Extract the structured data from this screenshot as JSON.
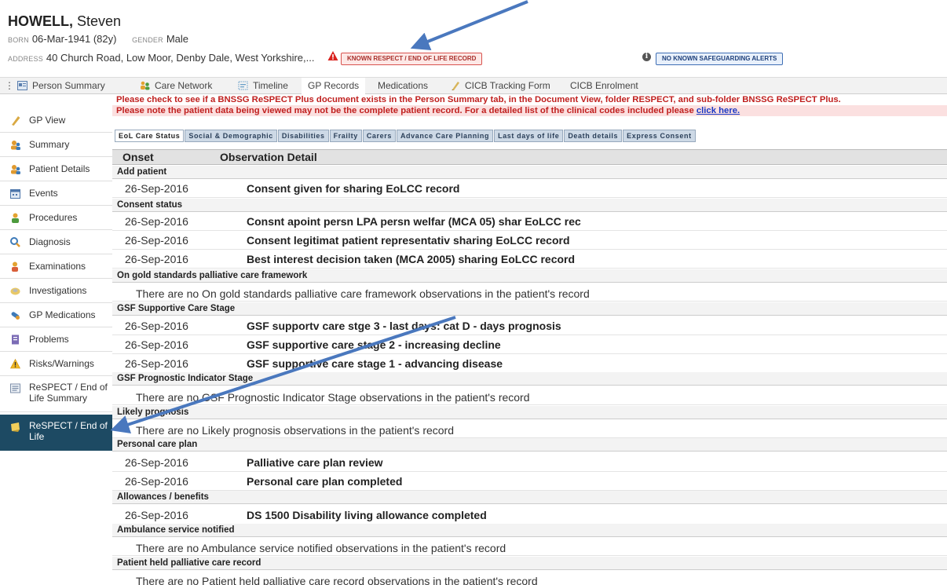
{
  "patient": {
    "surname": "HOWELL,",
    "forename": "Steven",
    "born_label": "BORN",
    "born_value": "06-Mar-1941 (82y)",
    "gender_label": "GENDER",
    "gender_value": "Male",
    "address_label": "ADDRESS",
    "address_value": "40 Church Road, Low Moor, Denby Dale, West Yorkshire,...",
    "respect_alert": "KNOWN RESPECT / END OF LIFE RECORD",
    "safeguarding_alert": "NO KNOWN SAFEGUARDING ALERTS"
  },
  "tabs": [
    {
      "label": "Person Summary",
      "icon": "person-summary-icon"
    },
    {
      "label": "Care Network",
      "icon": "care-network-icon"
    },
    {
      "label": "Timeline",
      "icon": "timeline-icon"
    },
    {
      "label": "GP Records",
      "icon": ""
    },
    {
      "label": "Medications",
      "icon": ""
    },
    {
      "label": "CICB Tracking Form",
      "icon": "form-icon"
    },
    {
      "label": "CICB Enrolment",
      "icon": ""
    }
  ],
  "active_tab": "GP Records",
  "sidebar": {
    "items": [
      {
        "label": "GP View",
        "icon": "gp-view-icon"
      },
      {
        "label": "Summary",
        "icon": "summary-icon"
      },
      {
        "label": "Patient Details",
        "icon": "patient-details-icon"
      },
      {
        "label": "Events",
        "icon": "events-icon"
      },
      {
        "label": "Procedures",
        "icon": "procedures-icon"
      },
      {
        "label": "Diagnosis",
        "icon": "diagnosis-icon"
      },
      {
        "label": "Examinations",
        "icon": "examinations-icon"
      },
      {
        "label": "Investigations",
        "icon": "investigations-icon"
      },
      {
        "label": "GP Medications",
        "icon": "gp-medications-icon"
      },
      {
        "label": "Problems",
        "icon": "problems-icon"
      },
      {
        "label": "Risks/Warnings",
        "icon": "warning-icon"
      },
      {
        "label": "ReSPECT / End of Life Summary",
        "icon": "respect-summary-icon"
      },
      {
        "label": "ReSPECT / End of Life",
        "icon": "respect-icon"
      }
    ],
    "active": "ReSPECT / End of Life"
  },
  "notices": {
    "respect_check": "Please check to see if a BNSSG ReSPECT Plus document exists in the Person Summary tab, in the Document View, folder RESPECT, and sub-folder BNSSG ReSPECT Plus.",
    "incomplete_record": "Please note the patient data being viewed may not be the complete patient record. For a detailed list of the clinical codes included please",
    "click_here": "click here."
  },
  "subtabs": [
    "EoL Care Status",
    "Social & Demographic",
    "Disabilities",
    "Frailty",
    "Carers",
    "Advance Care Planning",
    "Last days of life",
    "Death details",
    "Express Consent"
  ],
  "table": {
    "col_onset": "Onset",
    "col_detail": "Observation Detail",
    "groups": [
      {
        "title": "Add patient",
        "rows": [
          {
            "onset": "26-Sep-2016",
            "detail": "Consent given for sharing EoLCC record"
          }
        ]
      },
      {
        "title": "Consent status",
        "rows": [
          {
            "onset": "26-Sep-2016",
            "detail": "Consnt apoint persn LPA persn welfar (MCA 05) shar EoLCC rec"
          },
          {
            "onset": "26-Sep-2016",
            "detail": "Consent legitimat patient representativ sharing EoLCC record"
          },
          {
            "onset": "26-Sep-2016",
            "detail": "Best interest decision taken (MCA 2005) sharing EoLCC record"
          }
        ]
      },
      {
        "title": "On gold standards palliative care framework",
        "empty": "There are no On gold standards palliative care framework observations in the patient's record"
      },
      {
        "title": "GSF Supportive Care Stage",
        "rows": [
          {
            "onset": "26-Sep-2016",
            "detail": "GSF supportv care stge 3 - last days: cat D - days prognosis"
          },
          {
            "onset": "26-Sep-2016",
            "detail": "GSF supportive care stage 2 - increasing decline"
          },
          {
            "onset": "26-Sep-2016",
            "detail": "GSF supportive care stage 1 - advancing disease"
          }
        ]
      },
      {
        "title": "GSF Prognostic Indicator Stage",
        "empty": "There are no GSF Prognostic Indicator Stage observations in the patient's record"
      },
      {
        "title": "Likely prognosis",
        "empty": "There are no Likely prognosis observations in the patient's record"
      },
      {
        "title": "Personal care plan",
        "rows": [
          {
            "onset": "26-Sep-2016",
            "detail": "Palliative care plan review"
          },
          {
            "onset": "26-Sep-2016",
            "detail": "Personal care plan completed"
          }
        ]
      },
      {
        "title": "Allowances / benefits",
        "rows": [
          {
            "onset": "26-Sep-2016",
            "detail": "DS 1500 Disability living allowance completed"
          }
        ]
      },
      {
        "title": "Ambulance service notified",
        "empty": "There are no Ambulance service notified observations in the patient's record"
      },
      {
        "title": "Patient held palliative care record",
        "empty": "There are no Patient held palliative care record observations in the patient's record"
      }
    ]
  },
  "colors": {
    "sidebar_active": "#1d4a63",
    "alert_red": "#c0201f",
    "annotation_arrow": "#4a78be"
  }
}
